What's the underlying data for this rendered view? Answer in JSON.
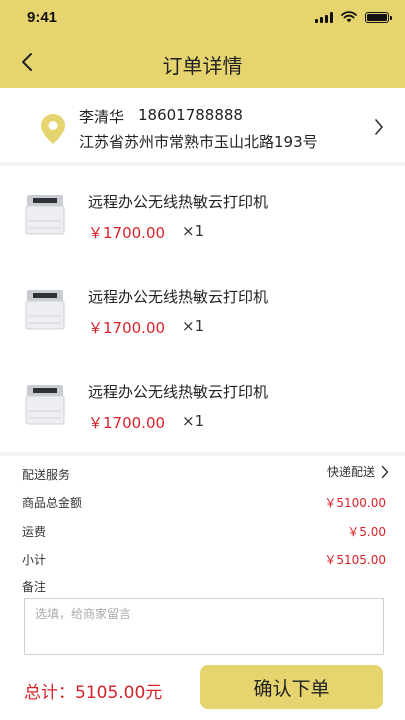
{
  "status_bar": {
    "time": "9:41"
  },
  "header": {
    "title": "订单详情"
  },
  "address": {
    "name": "李清华",
    "phone": "18601788888",
    "detail": "江苏省苏州市常熟市玉山北路193号"
  },
  "products": [
    {
      "name": "远程办公无线热敏云打印机",
      "price": "￥1700.00",
      "qty": "×1"
    },
    {
      "name": "远程办公无线热敏云打印机",
      "price": "￥1700.00",
      "qty": "×1"
    },
    {
      "name": "远程办公无线热敏云打印机",
      "price": "￥1700.00",
      "qty": "×1"
    }
  ],
  "summary": {
    "shipping_label": "配送服务",
    "shipping_value": "快递配送",
    "goods_total_label": "商品总金额",
    "goods_total_value": "￥5100.00",
    "freight_label": "运费",
    "freight_value": "￥5.00",
    "subtotal_label": "小计",
    "subtotal_value": "￥5105.00",
    "note_label": "备注",
    "note_placeholder": "选填，给商家留言"
  },
  "footer": {
    "total": "总计：5105.00元",
    "confirm_label": "确认下单"
  },
  "colors": {
    "accent": "#e6d56f",
    "price": "#d8222a"
  }
}
